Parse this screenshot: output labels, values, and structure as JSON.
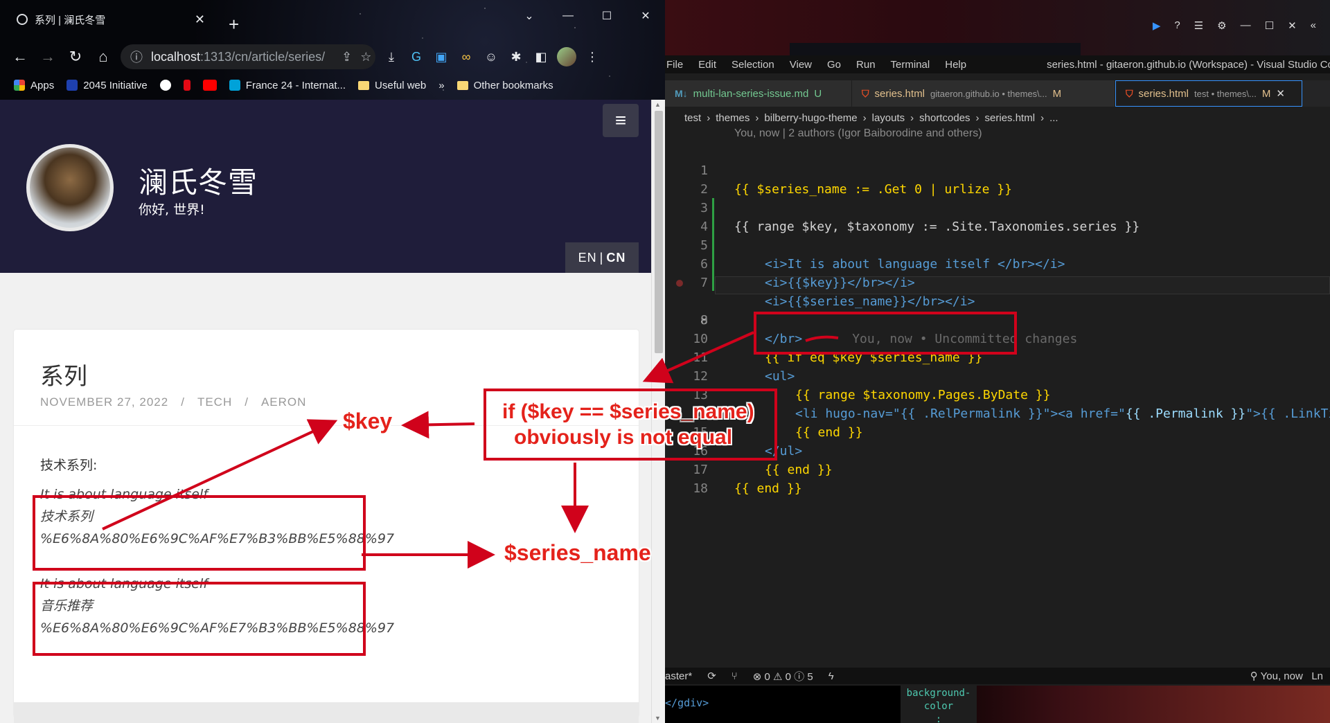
{
  "browser": {
    "tab_title": "系列 | 澜氏冬雪",
    "new_tab": "+",
    "url_host": "localhost",
    "url_path": ":1313/cn/article/series/",
    "window_controls": [
      "⌄",
      "—",
      "☐",
      "✕"
    ],
    "bookmarks": [
      "Apps",
      "2045 Initiative",
      "France 24 - Internat...",
      "Useful web"
    ],
    "bookmarks_more": "»",
    "other_bookmarks": "Other bookmarks"
  },
  "site": {
    "title": "澜氏冬雪",
    "subtitle": "你好, 世界!",
    "lang_en": "EN",
    "lang_sep": "|",
    "lang_cn": "CN",
    "menu_icon": "≡"
  },
  "post": {
    "title": "系列",
    "date": "NOVEMBER 27, 2022",
    "category": "TECH",
    "author": "AERON",
    "intro": "技术系列:",
    "entries": [
      {
        "line1": "It is about language itself",
        "line2": "技术系列",
        "line3": "%E6%8A%80%E6%9C%AF%E7%B3%BB%E5%88%97"
      },
      {
        "line1": "It is about language itself",
        "line2": "音乐推荐",
        "line3": "%E6%8A%80%E6%9C%AF%E7%B3%BB%E5%88%97"
      }
    ]
  },
  "vscode": {
    "menu": [
      "File",
      "Edit",
      "Selection",
      "View",
      "Go",
      "Run",
      "Terminal",
      "Help"
    ],
    "window_title": "series.html - gitaeron.github.io (Workspace) - Visual Studio Code",
    "tabs": [
      {
        "icon": "M↓",
        "name": "multi-lan-series-issue.md",
        "desc": "",
        "status": "U"
      },
      {
        "icon": "⛉",
        "name": "series.html",
        "desc": "gitaeron.github.io • themes\\...",
        "status": "M"
      },
      {
        "icon": "⛉",
        "name": "series.html",
        "desc": "test • themes\\...",
        "status": "M"
      }
    ],
    "breadcrumb": [
      "test",
      "themes",
      "bilberry-hugo-theme",
      "layouts",
      "shortcodes",
      "series.html",
      "..."
    ],
    "blame_header": "You, now | 2 authors (Igor Baiborodine and others)",
    "line_numbers": [
      "1",
      "2",
      "3",
      "4",
      "5",
      "6",
      "7",
      "8",
      "9",
      "10",
      "11",
      "12",
      "13",
      "14",
      "15",
      "16",
      "17",
      "18"
    ],
    "code": {
      "l1": "{{ $series_name := .Get 0 | urlize }}",
      "l3": "{{ range $key, $taxonomy := .Site.Taxonomies.series }}",
      "l5": "<i>It is about language itself </br></i>",
      "l6": "<i>{{$key}}</br></i>",
      "l7": "<i>{{$series_name}}</br></i>",
      "l8": "</br>",
      "l8_ghost": "You, now • Uncommitted changes",
      "l10": "{{ if eq $key $series_name }}",
      "l11": "<ul>",
      "l12": "{{ range $taxonomy.Pages.ByDate }}",
      "l13a": "<li hugo-nav=\"{{ .RelPermalink }}\"><a href=\"",
      "l13b": "{{ .Permalink }}",
      "l13c": "\">{{ .LinkTitle }}",
      "l14": "{{ end }}",
      "l15": "</ul>",
      "l16": "{{ end }}",
      "l17": "{{ end }}"
    },
    "status": {
      "branch": "aster*",
      "sync": "⟳",
      "errors": "⊗ 0",
      "warnings": "⚠ 0",
      "info": "ⓘ 5",
      "bolt": "ϟ",
      "blame": "You, now",
      "ln": "Ln"
    },
    "bottom_code": "</gdiv>",
    "bottom_hint": "background-\ncolor\n:"
  },
  "annotations": {
    "key": "$key",
    "series_name": "$series_name",
    "cond_line1": "if ($key == $series_name)",
    "cond_line2": "obviously is not equal"
  },
  "colors": {
    "annotation_red": "#d0021b",
    "site_header": "#1f1d3a",
    "vscode_bg": "#1e1e1e"
  }
}
